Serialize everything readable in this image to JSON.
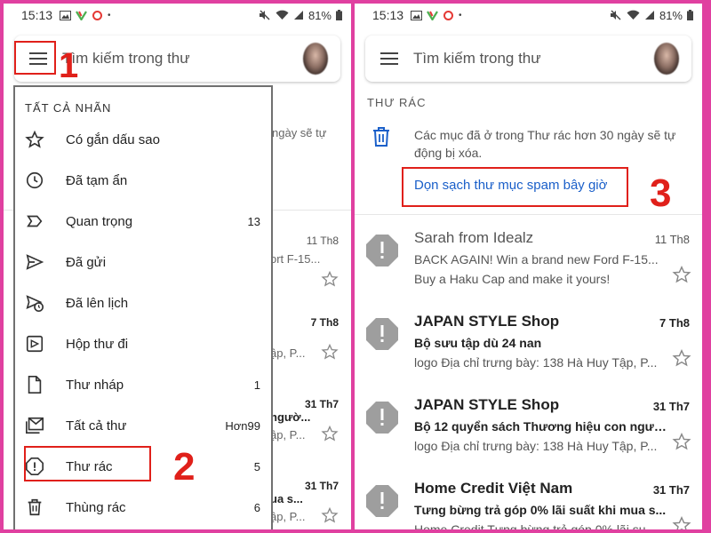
{
  "colors": {
    "frame": "#e040a0",
    "highlight": "#e0201a",
    "link": "#1a5fc9",
    "spam_icon": "#9e9e9e"
  },
  "statusbar": {
    "time": "15:13",
    "battery": "81%"
  },
  "left": {
    "search_placeholder": "Tìm kiếm trong thư",
    "step1": "1",
    "step2": "2",
    "drawer": {
      "header": "TẤT CẢ NHÃN",
      "items": [
        {
          "label": "Có gắn dấu sao",
          "icon": "star-icon",
          "count": ""
        },
        {
          "label": "Đã tạm ẩn",
          "icon": "clock-icon",
          "count": ""
        },
        {
          "label": "Quan trọng",
          "icon": "important-icon",
          "count": "13"
        },
        {
          "label": "Đã gửi",
          "icon": "send-icon",
          "count": ""
        },
        {
          "label": "Đã lên lịch",
          "icon": "scheduled-icon",
          "count": ""
        },
        {
          "label": "Hộp thư đi",
          "icon": "outbox-icon",
          "count": ""
        },
        {
          "label": "Thư nháp",
          "icon": "draft-icon",
          "count": "1"
        },
        {
          "label": "Tất cả thư",
          "icon": "all-mail-icon",
          "count": "Hơn99"
        },
        {
          "label": "Thư rác",
          "icon": "spam-icon",
          "count": "5"
        },
        {
          "label": "Thùng rác",
          "icon": "trash-icon",
          "count": "6"
        }
      ]
    },
    "bg": {
      "info": "ngày sẽ tự",
      "emails": [
        {
          "date": "11 Th8",
          "line1": "ort F-15...",
          "line2": ""
        },
        {
          "date": "7 Th8",
          "line1": "",
          "line2": "ập, P..."
        },
        {
          "date": "31 Th7",
          "line1": "ngườ...",
          "line2": "ập, P..."
        },
        {
          "date": "31 Th7",
          "line1": "ua s...",
          "line2": "ập, P..."
        }
      ]
    }
  },
  "right": {
    "search_placeholder": "Tìm kiếm trong thư",
    "section_title": "THƯ RÁC",
    "info": "Các mục đã ở trong Thư rác hơn 30 ngày sẽ tự động bị xóa.",
    "empty_button": "Dọn sạch thư mục spam bây giờ",
    "step3": "3",
    "emails": [
      {
        "sender": "Sarah from Idealz",
        "date": "11 Th8",
        "subject": "BACK AGAIN! Win a brand new Ford F-15...",
        "preview": "Buy a Haku Cap and make it yours!",
        "read": true
      },
      {
        "sender": "JAPAN STYLE Shop",
        "date": "7 Th8",
        "subject": "Bộ sưu tập dù 24 nan",
        "preview": "logo Địa chỉ trưng bày: 138 Hà Huy Tập, P...",
        "read": false
      },
      {
        "sender": "JAPAN STYLE Shop",
        "date": "31 Th7",
        "subject": "Bộ 12 quyển sách Thương hiệu con ngườ...",
        "preview": "logo Địa chỉ trưng bày: 138 Hà Huy Tập, P...",
        "read": false
      },
      {
        "sender": "Home Credit Việt Nam",
        "date": "31 Th7",
        "subject": "Tưng bừng trả góp 0% lãi suất khi mua s...",
        "preview": "Home Credit Tưng bừng trả góp 0% lãi su...",
        "read": false
      }
    ]
  }
}
